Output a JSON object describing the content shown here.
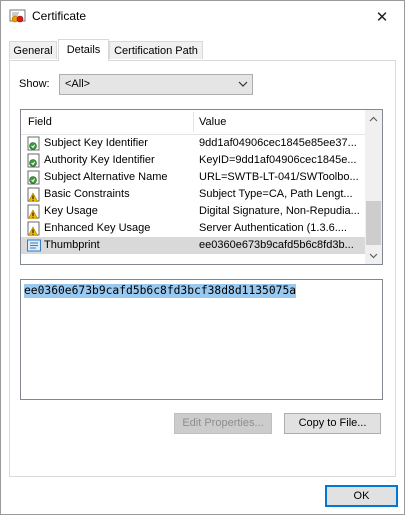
{
  "window": {
    "title": "Certificate",
    "close_glyph": "✕"
  },
  "tabs": [
    {
      "label": "General",
      "active": false
    },
    {
      "label": "Details",
      "active": true
    },
    {
      "label": "Certification Path",
      "active": false
    }
  ],
  "show": {
    "label": "Show:",
    "selected": "<All>"
  },
  "fields_list": {
    "columns": {
      "field": "Field",
      "value": "Value"
    },
    "rows": [
      {
        "icon": "cert-field-icon",
        "field": "Subject Key Identifier",
        "value": "9dd1af04906cec1845e85ee37..."
      },
      {
        "icon": "cert-field-icon",
        "field": "Authority Key Identifier",
        "value": "KeyID=9dd1af04906cec1845e..."
      },
      {
        "icon": "cert-field-icon",
        "field": "Subject Alternative Name",
        "value": "URL=SWTB-LT-041/SWToolbo..."
      },
      {
        "icon": "cert-warning-icon",
        "field": "Basic Constraints",
        "value": "Subject Type=CA, Path Lengt..."
      },
      {
        "icon": "cert-warning-icon",
        "field": "Key Usage",
        "value": "Digital Signature, Non-Repudia..."
      },
      {
        "icon": "cert-warning-icon",
        "field": "Enhanced Key Usage",
        "value": "Server Authentication (1.3.6...."
      },
      {
        "icon": "thumbprint-icon",
        "field": "Thumbprint",
        "value": "ee0360e673b9cafd5b6c8fd3b...",
        "selected": true
      }
    ]
  },
  "value_box": {
    "text": "ee0360e673b9cafd5b6c8fd3bcf38d8d1135075a"
  },
  "buttons": {
    "edit_properties": "Edit Properties...",
    "copy_to_file": "Copy to File...",
    "ok": "OK"
  },
  "colors": {
    "selection_highlight": "#99c9ef",
    "ok_border": "#0078d7",
    "warning_icon": "#f2b705"
  }
}
